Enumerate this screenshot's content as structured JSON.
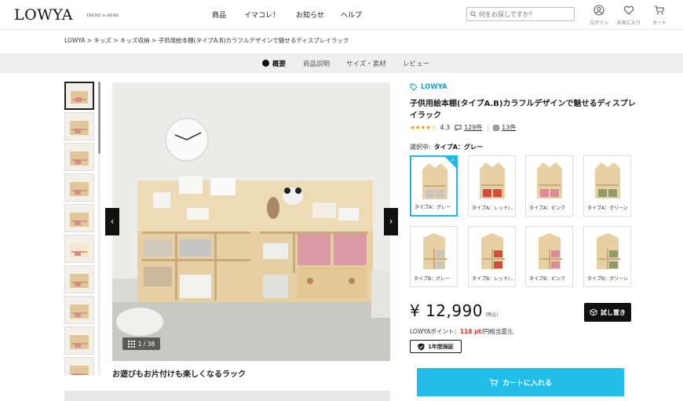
{
  "header": {
    "logo": "LOWYA",
    "logo_tagline": "TREND is HERE",
    "nav": [
      "商品",
      "イマコレ！",
      "お知らせ",
      "ヘルプ"
    ],
    "search_placeholder": "何をお探しですか？",
    "icons": [
      {
        "name": "login-icon",
        "label": "ログイン"
      },
      {
        "name": "heart-icon",
        "label": "お気に入り"
      },
      {
        "name": "cart-icon",
        "label": "カート"
      }
    ]
  },
  "breadcrumb": "LOWYA > キッズ > キッズ収納 > 子供用絵本棚(タイプA.B)カラフルデザインで魅せるディスプレイラック",
  "tabs": [
    "概要",
    "商品説明",
    "サイズ・素材",
    "レビュー"
  ],
  "gallery": {
    "counter": "1 / 38",
    "caption": "お遊びもお片付けも楽しくなるラック",
    "prev_icon": "chevron-left-icon",
    "next_icon": "chevron-right-icon"
  },
  "product": {
    "brand": "LOWYA",
    "title": "子供用絵本棚(タイプA.B)カラフルデザインで魅せるディスプレイラック",
    "rating": "4.3",
    "stars": "★★★★☆",
    "reviews": "129件",
    "photos": "13件",
    "selected_prefix": "選択中:",
    "selected_value": "タイプA：グレー",
    "variants": [
      {
        "label": "タイプA：グレー",
        "color": "#c9c6c0"
      },
      {
        "label": "タイプA：レッド/...",
        "color": "#d44c3d"
      },
      {
        "label": "タイプA：ピンク",
        "color": "#d98b98"
      },
      {
        "label": "タイプA：グリーン",
        "color": "#8e9c6d"
      },
      {
        "label": "タイプB：グレー",
        "color": "#c9c6c0"
      },
      {
        "label": "タイプB：レッド/...",
        "color": "#d44c3d"
      },
      {
        "label": "タイプB：ピンク",
        "color": "#d98b98"
      },
      {
        "label": "タイプB：グリーン",
        "color": "#8e9c6d"
      }
    ],
    "price": "¥ 12,990",
    "tax_note": "(税込)",
    "try_button": "試し置き",
    "points_prefix": "LOWYAポイント：",
    "points_value": "118 pt",
    "points_suffix": "/円相当還元",
    "warranty": "1年間保証",
    "cart_button": "カートに入れる"
  },
  "colors": {
    "accent": "#22bde9",
    "brand_text": "#1a9ec9",
    "points": "#e2332c"
  }
}
